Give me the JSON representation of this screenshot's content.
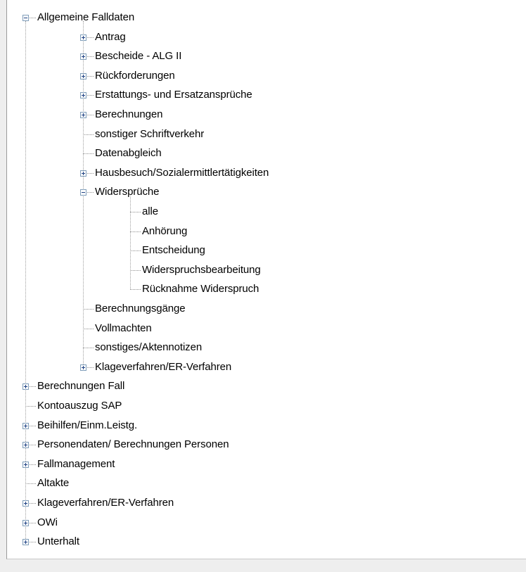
{
  "tree": {
    "nodes": [
      {
        "label": "Allgemeine Falldaten",
        "depth": 0,
        "expander": "minus"
      },
      {
        "label": "Antrag",
        "depth": 1,
        "expander": "plus"
      },
      {
        "label": "Bescheide - ALG II",
        "depth": 1,
        "expander": "plus"
      },
      {
        "label": "Rückforderungen",
        "depth": 1,
        "expander": "plus"
      },
      {
        "label": "Erstattungs- und Ersatzansprüche",
        "depth": 1,
        "expander": "plus"
      },
      {
        "label": "Berechnungen",
        "depth": 1,
        "expander": "plus"
      },
      {
        "label": "sonstiger Schriftverkehr",
        "depth": 1,
        "expander": "none"
      },
      {
        "label": "Datenabgleich",
        "depth": 1,
        "expander": "none"
      },
      {
        "label": "Hausbesuch/Sozialermittlertätigkeiten",
        "depth": 1,
        "expander": "plus"
      },
      {
        "label": "Widersprüche",
        "depth": 1,
        "expander": "minus"
      },
      {
        "label": "alle",
        "depth": 2,
        "expander": "none"
      },
      {
        "label": "Anhörung",
        "depth": 2,
        "expander": "none"
      },
      {
        "label": "Entscheidung",
        "depth": 2,
        "expander": "none"
      },
      {
        "label": "Widerspruchsbearbeitung",
        "depth": 2,
        "expander": "none"
      },
      {
        "label": "Rücknahme Widerspruch",
        "depth": 2,
        "expander": "none"
      },
      {
        "label": "Berechnungsgänge",
        "depth": 1,
        "expander": "none"
      },
      {
        "label": "Vollmachten",
        "depth": 1,
        "expander": "none"
      },
      {
        "label": "sonstiges/Aktennotizen",
        "depth": 1,
        "expander": "none"
      },
      {
        "label": "Klageverfahren/ER-Verfahren",
        "depth": 1,
        "expander": "plus"
      },
      {
        "label": "Berechnungen Fall",
        "depth": 0,
        "expander": "plus"
      },
      {
        "label": "Kontoauszug SAP",
        "depth": 0,
        "expander": "none"
      },
      {
        "label": "Beihilfen/Einm.Leistg.",
        "depth": 0,
        "expander": "plus"
      },
      {
        "label": "Personendaten/ Berechnungen Personen",
        "depth": 0,
        "expander": "plus"
      },
      {
        "label": "Fallmanagement",
        "depth": 0,
        "expander": "plus"
      },
      {
        "label": "Altakte",
        "depth": 0,
        "expander": "none"
      },
      {
        "label": "Klageverfahren/ER-Verfahren",
        "depth": 0,
        "expander": "plus"
      },
      {
        "label": "OWi",
        "depth": 0,
        "expander": "plus"
      },
      {
        "label": "Unterhalt",
        "depth": 0,
        "expander": "plus"
      }
    ]
  },
  "colors": {
    "panel_background": "#ffffff",
    "outer_background": "#eeeeee",
    "dotted_line": "#8e8e8e",
    "expander_border": "#7f9db9",
    "expander_glyph": "#1c3f82"
  },
  "icons": {
    "expand": "plus-box-icon",
    "collapse": "minus-box-icon"
  }
}
